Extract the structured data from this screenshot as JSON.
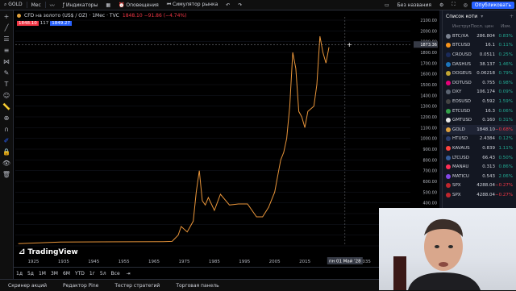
{
  "topbar": {
    "symbol": "GOLD",
    "interval": "Мес",
    "indicators": "Индикаторы",
    "alerts": "Оповещения",
    "replay": "Симулятор рынка",
    "save_status": "Без названия",
    "publish": "Опубликовать"
  },
  "legend": {
    "title": "CFD на золото (US$ / OZ) · 1Мес · TVC",
    "ohlc": "1848.10 −91.86 (−4.74%)",
    "bid": "1848.10",
    "spread": "117",
    "ask": "1849.27"
  },
  "axis": {
    "crosshair_price": "1873.36",
    "crosshair_date": "пн 01 Май '28",
    "y_ticks": [
      "2100.00",
      "2000.00",
      "1900.00",
      "1800.00",
      "1700.00",
      "1600.00",
      "1500.00",
      "1400.00",
      "1300.00",
      "1200.00",
      "1100.00",
      "1000.00",
      "900.00",
      "800.00",
      "700.00",
      "600.00",
      "500.00",
      "400.00",
      "300.00",
      "200.00",
      "100.00",
      "0.00"
    ],
    "x_ticks": [
      "1925",
      "1935",
      "1945",
      "1955",
      "1965",
      "1975",
      "1985",
      "1995",
      "2005",
      "2015",
      "2035",
      "2045"
    ]
  },
  "chart_data": {
    "type": "line",
    "title": "CFD на золото (US$ / OZ) · 1Мес · TVC",
    "xlabel": "",
    "ylabel": "",
    "series": [
      {
        "name": "GOLD",
        "color": "#e9953a",
        "x": [
          1920,
          1934,
          1968,
          1971,
          1973,
          1974,
          1976,
          1978,
          1979,
          1980,
          1981,
          1982,
          1983,
          1985,
          1987,
          1990,
          1993,
          1996,
          1999,
          2001,
          2003,
          2005,
          2006,
          2007,
          2008,
          2009,
          2010,
          2011,
          2012,
          2013,
          2014,
          2015,
          2016,
          2018,
          2019,
          2020,
          2021,
          2022,
          2023
        ],
        "y": [
          20,
          35,
          40,
          42,
          100,
          180,
          130,
          230,
          500,
          700,
          420,
          380,
          450,
          330,
          480,
          380,
          390,
          390,
          270,
          270,
          360,
          500,
          650,
          800,
          870,
          1000,
          1300,
          1800,
          1650,
          1250,
          1200,
          1100,
          1250,
          1300,
          1500,
          1950,
          1800,
          1700,
          1848
        ]
      }
    ],
    "xlim": [
      1919,
      2050
    ],
    "ylim": [
      0,
      2130
    ]
  },
  "bottom": {
    "ranges": [
      "1д",
      "5д",
      "1М",
      "3М",
      "6М",
      "YTD",
      "1г",
      "5л",
      "Все"
    ],
    "brand": "TradingView"
  },
  "watchlist": {
    "title": "Список коти",
    "columns": [
      "Инструм",
      "Посл. цен",
      "Изм."
    ],
    "rows": [
      {
        "sym": "BTC/XA",
        "last": "286.804",
        "chg": "0.83%",
        "dir": "pos",
        "icon": "#7b8290"
      },
      {
        "sym": "BTCUSD",
        "last": "16.1",
        "chg": "0.11%",
        "dir": "pos",
        "icon": "#f7931a"
      },
      {
        "sym": "CROUSD",
        "last": "0.0511",
        "chg": "0.25%",
        "dir": "pos",
        "icon": "#1a2a5a"
      },
      {
        "sym": "DASHUS",
        "last": "38.137",
        "chg": "1.46%",
        "dir": "pos",
        "icon": "#1c75bc"
      },
      {
        "sym": "DOGEUS",
        "last": "0.06218",
        "chg": "0.79%",
        "dir": "pos",
        "icon": "#c2a633"
      },
      {
        "sym": "DOTUSD",
        "last": "0.755",
        "chg": "0.98%",
        "dir": "pos",
        "icon": "#e6007a"
      },
      {
        "sym": "DXY",
        "last": "106.174",
        "chg": "0.09%",
        "dir": "pos",
        "icon": "#5b6472"
      },
      {
        "sym": "EOSUSD",
        "last": "0.592",
        "chg": "1.59%",
        "dir": "pos",
        "icon": "#444"
      },
      {
        "sym": "ETCUSD",
        "last": "16.3",
        "chg": "0.06%",
        "dir": "pos",
        "icon": "#33a14a"
      },
      {
        "sym": "GMTUSD",
        "last": "0.160",
        "chg": "0.31%",
        "dir": "pos",
        "icon": "#e7e7e7"
      },
      {
        "sym": "GOLD",
        "last": "1848.10",
        "chg": "−0.68%",
        "dir": "neg",
        "icon": "#e0a13c"
      },
      {
        "sym": "HTUSD",
        "last": "2.4384",
        "chg": "0.12%",
        "dir": "pos",
        "icon": "#2a3d6e"
      },
      {
        "sym": "KAVAUS",
        "last": "0.839",
        "chg": "1.11%",
        "dir": "pos",
        "icon": "#ff433e"
      },
      {
        "sym": "LTCUSD",
        "last": "66.43",
        "chg": "0.50%",
        "dir": "pos",
        "icon": "#345d9d"
      },
      {
        "sym": "MANAU",
        "last": "0.313",
        "chg": "0.86%",
        "dir": "pos",
        "icon": "#ff2d55"
      },
      {
        "sym": "MATICU",
        "last": "0.543",
        "chg": "2.06%",
        "dir": "pos",
        "icon": "#8247e5"
      },
      {
        "sym": "SPX",
        "last": "4288.04",
        "chg": "−0.27%",
        "dir": "neg",
        "icon": "#c0262d"
      },
      {
        "sym": "SPX",
        "last": "4288.04",
        "chg": "−0.27%",
        "dir": "neg",
        "icon": "#c0262d"
      }
    ]
  },
  "footer": {
    "tabs": [
      "Скринер акций",
      "Редактор Pine",
      "Тестер стратегий",
      "Торговая панель"
    ]
  },
  "colors": {
    "accent": "#2962ff",
    "line": "#e9953a",
    "up": "#22ab94",
    "down": "#f23645"
  }
}
